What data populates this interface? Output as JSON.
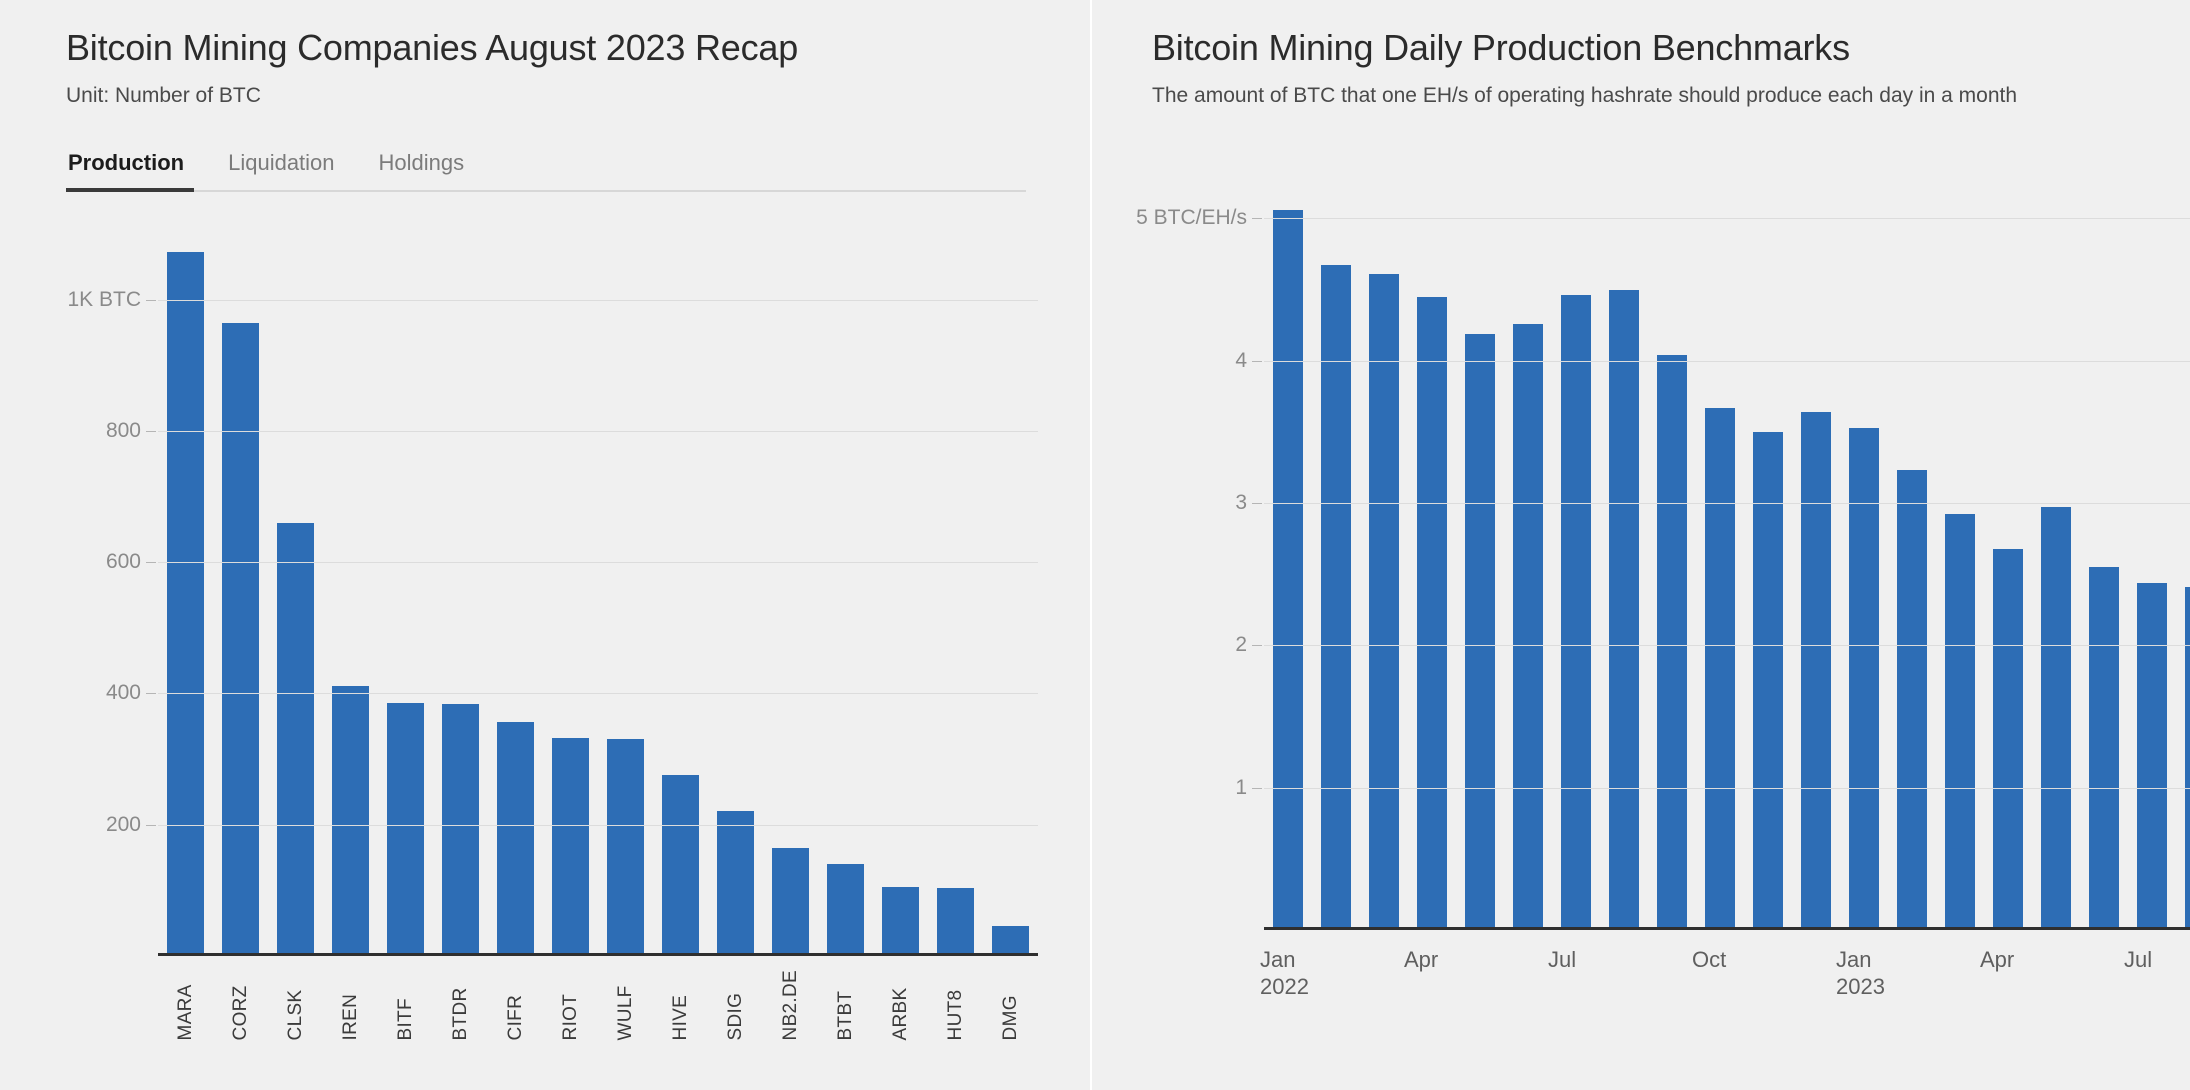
{
  "left_panel": {
    "title": "Bitcoin Mining Companies August 2023 Recap",
    "subtitle": "Unit: Number of BTC",
    "tabs": [
      {
        "label": "Production",
        "active": true
      },
      {
        "label": "Liquidation",
        "active": false
      },
      {
        "label": "Holdings",
        "active": false
      }
    ]
  },
  "right_panel": {
    "title": "Bitcoin Mining Daily Production Benchmarks",
    "subtitle": "The amount of BTC that one EH/s of operating hashrate should produce each day in a month"
  },
  "colors": {
    "bar": "#2d6db5",
    "background": "#f0f0f0",
    "gridline": "#dcdcdc",
    "axis": "#2f2f2f",
    "tick_text": "#8a8a8a"
  },
  "chart_data": [
    {
      "type": "bar",
      "title": "Bitcoin Mining Companies August 2023 Recap",
      "subtitle": "Unit: Number of BTC",
      "xlabel": "",
      "ylabel": "BTC",
      "ylim": [
        0,
        1100
      ],
      "grid": true,
      "legend": "none",
      "ytick_labels": [
        "1K BTC",
        "800",
        "600",
        "400",
        "200"
      ],
      "ytick_values": [
        1000,
        800,
        600,
        400,
        200
      ],
      "categories": [
        "MARA",
        "CORZ",
        "CLSK",
        "IREN",
        "BITF",
        "BTDR",
        "CIFR",
        "RIOT",
        "WULF",
        "HIVE",
        "SDIG",
        "NB2.DE",
        "BTBT",
        "ARBK",
        "HUT8",
        "DMG"
      ],
      "values": [
        1072,
        964,
        659,
        411,
        385,
        384,
        357,
        332,
        331,
        276,
        221,
        165,
        140,
        105,
        103,
        46
      ]
    },
    {
      "type": "bar",
      "title": "Bitcoin Mining Daily Production Benchmarks",
      "subtitle": "The amount of BTC that one EH/s of operating hashrate should produce each day in a month",
      "xlabel": "",
      "ylabel": "BTC/EH/s",
      "ylim": [
        0,
        5.2
      ],
      "grid": true,
      "legend": "none",
      "ytick_labels": [
        "5 BTC/EH/s",
        "4",
        "3",
        "2",
        "1"
      ],
      "ytick_values": [
        5,
        4,
        3,
        2,
        1
      ],
      "x": [
        "Jan 2022",
        "Feb 2022",
        "Mar 2022",
        "Apr 2022",
        "May 2022",
        "Jun 2022",
        "Jul 2022",
        "Aug 2022",
        "Sep 2022",
        "Oct 2022",
        "Nov 2022",
        "Dec 2022",
        "Jan 2023",
        "Feb 2023",
        "Mar 2023",
        "Apr 2023",
        "May 2023",
        "Jun 2023",
        "Jul 2023",
        "Aug 2023"
      ],
      "xtick_labels": [
        {
          "month": "Jan",
          "year": "2022",
          "index": 0
        },
        {
          "month": "Apr",
          "year": "",
          "index": 3
        },
        {
          "month": "Jul",
          "year": "",
          "index": 6
        },
        {
          "month": "Oct",
          "year": "",
          "index": 9
        },
        {
          "month": "Jan",
          "year": "2023",
          "index": 12
        },
        {
          "month": "Apr",
          "year": "",
          "index": 15
        },
        {
          "month": "Jul",
          "year": "",
          "index": 18
        }
      ],
      "values": [
        5.06,
        4.67,
        4.61,
        4.45,
        4.19,
        4.26,
        4.46,
        4.5,
        4.04,
        3.67,
        3.5,
        3.64,
        3.53,
        3.23,
        2.92,
        2.68,
        2.97,
        2.55,
        2.44,
        2.41
      ]
    }
  ]
}
